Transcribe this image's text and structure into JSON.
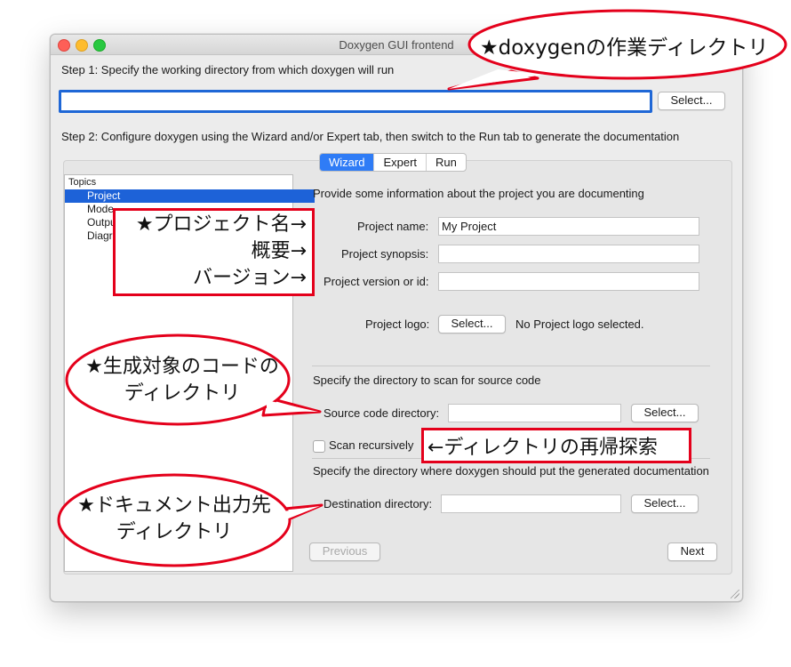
{
  "window": {
    "title": "Doxygen GUI frontend"
  },
  "step1": {
    "text": "Step 1: Specify the working directory from which doxygen will run",
    "working_dir_value": "",
    "select_label": "Select..."
  },
  "step2": {
    "text": "Step 2: Configure doxygen using the Wizard and/or Expert tab, then switch to the Run tab to generate the documentation"
  },
  "tabs": [
    {
      "label": "Wizard",
      "active": true
    },
    {
      "label": "Expert",
      "active": false
    },
    {
      "label": "Run",
      "active": false
    }
  ],
  "topics": {
    "header": "Topics",
    "items": [
      {
        "label": "Project",
        "selected": true
      },
      {
        "label": "Mode"
      },
      {
        "label": "Output"
      },
      {
        "label": "Diagrams"
      }
    ]
  },
  "project": {
    "intro": "Provide some information about the project you are documenting",
    "name_label": "Project name:",
    "name_value": "My Project",
    "synopsis_label": "Project synopsis:",
    "synopsis_value": "",
    "version_label": "Project version or id:",
    "version_value": "",
    "logo_label": "Project logo:",
    "logo_select_label": "Select...",
    "logo_status": "No Project logo selected."
  },
  "source": {
    "intro": "Specify the directory to scan for source code",
    "dir_label": "Source code directory:",
    "dir_value": "",
    "select_label": "Select...",
    "recursive_label": "Scan recursively",
    "recursive_checked": false
  },
  "destination": {
    "intro": "Specify the directory where doxygen should put the generated documentation",
    "dir_label": "Destination directory:",
    "dir_value": "",
    "select_label": "Select..."
  },
  "nav": {
    "previous_label": "Previous",
    "next_label": "Next"
  },
  "annotations": {
    "working_dir": "★doxygenの作業ディレクトリ",
    "project_fields": {
      "line1": "★プロジェクト名→",
      "line2": "概要→",
      "line3": "バージョン→"
    },
    "source_dir": {
      "line1": "★生成対象のコードの",
      "line2": "ディレクトリ"
    },
    "recursive": "←ディレクトリの再帰探索",
    "dest_dir": {
      "line1": "★ドキュメント出力先",
      "line2": "ディレクトリ"
    },
    "color": "#e4001b"
  }
}
